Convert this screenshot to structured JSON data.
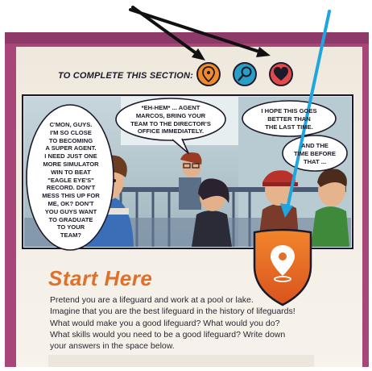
{
  "section_label": "TO COMPLETE THIS SECTION:",
  "icons": [
    "location-pin-icon",
    "magnifier-icon",
    "heart-icon"
  ],
  "comic": {
    "bubble1": [
      "C'MON, GUYS.",
      "I'M SO CLOSE",
      "TO BECOMING",
      "A SUPER AGENT.",
      "I NEED JUST ONE",
      "MORE SIMULATOR",
      "WIN TO BEAT",
      "\"EAGLE EYE'S\"",
      "RECORD. DON'T",
      "MESS THIS UP FOR",
      "ME, OK? DON'T",
      "YOU GUYS WANT",
      "TO GRADUATE",
      "TO YOUR",
      "TEAM?"
    ],
    "bubble2": [
      "*EH-HEM* ... AGENT",
      "MARCOS, BRING YOUR",
      "TEAM TO THE DIRECTOR'S",
      "OFFICE IMMEDIATELY."
    ],
    "bubble3": [
      "I HOPE THIS GOES",
      "BETTER THAN",
      "THE LAST TIME."
    ],
    "bubble4": [
      "AND THE",
      "TIME BEFORE",
      "THAT ..."
    ]
  },
  "heading": "Start Here",
  "body_lines": [
    "Pretend you are a lifeguard and work at a pool or lake.",
    "Imagine that you are the best lifeguard in the history of lifeguards!",
    "What would make you a good lifeguard? What would you do?",
    "What skills would you need to be a good lifeguard? Write down",
    "your answers in the space below."
  ],
  "colors": {
    "border": "#a8467a",
    "page": "#f6f1ea",
    "accent": "#e0702a",
    "pin_badge": "#f08a2c",
    "search_badge": "#2a9fc6",
    "heart_badge": "#e04a4a",
    "blue_arrow": "#1ea6e0",
    "black_arrow": "#111111"
  }
}
